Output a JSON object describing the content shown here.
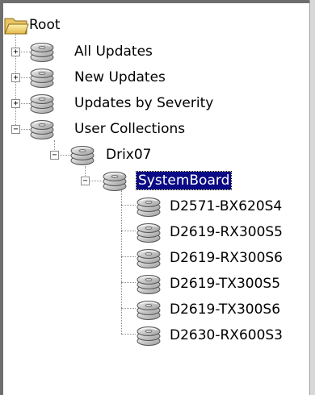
{
  "tree": {
    "root": {
      "label": "Root"
    },
    "all_updates": {
      "label": "All Updates",
      "toggle": "+"
    },
    "new_updates": {
      "label": "New Updates",
      "toggle": "+"
    },
    "updates_by_severity": {
      "label": "Updates by Severity",
      "toggle": "+"
    },
    "user_collections": {
      "label": "User Collections",
      "toggle": "−"
    },
    "drix07": {
      "label": "Drix07",
      "toggle": "−"
    },
    "systemboard": {
      "label": "SystemBoard",
      "toggle": "−",
      "selected": true
    },
    "leaves": [
      {
        "label": "D2571-BX620S4"
      },
      {
        "label": "D2619-RX300S5"
      },
      {
        "label": "D2619-RX300S6"
      },
      {
        "label": "D2619-TX300S5"
      },
      {
        "label": "D2619-TX300S6"
      },
      {
        "label": "D2630-RX600S3"
      }
    ]
  },
  "colors": {
    "selection_bg": "#0a0a86",
    "selection_text": "#ffffff",
    "tree_lines": "#8a8a8a"
  }
}
